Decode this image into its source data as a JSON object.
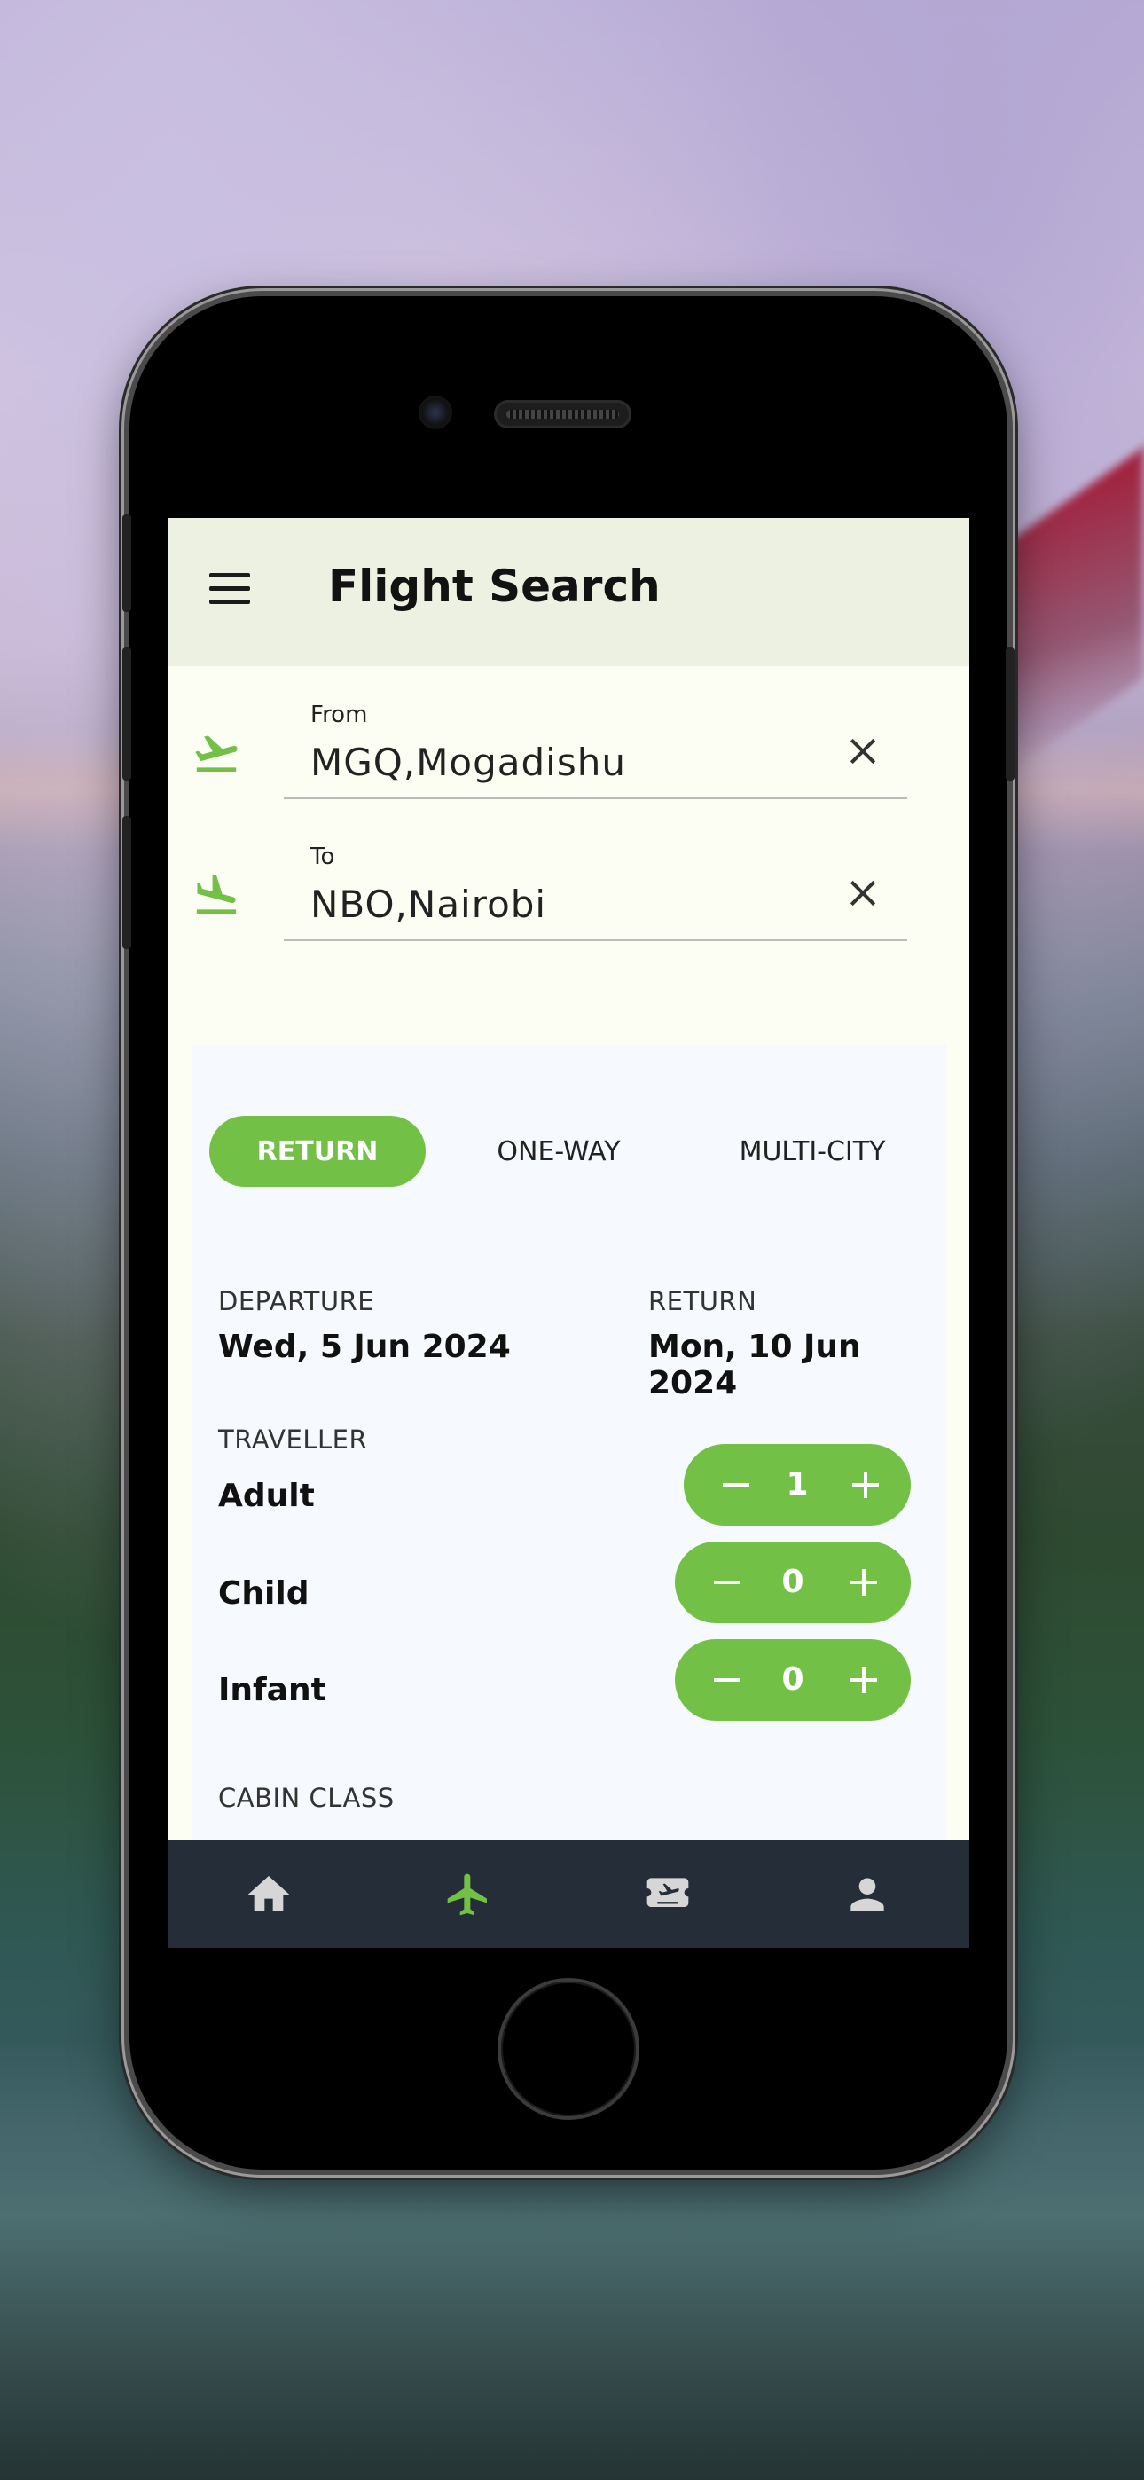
{
  "app": {
    "title": "Flight Search"
  },
  "route": {
    "from": {
      "label": "From",
      "value": "MGQ,Mogadishu"
    },
    "to": {
      "label": "To",
      "value": "NBO,Nairobi"
    }
  },
  "trip_type": {
    "options": [
      "RETURN",
      "ONE-WAY",
      "MULTI-CITY"
    ],
    "selected": "RETURN"
  },
  "dates": {
    "departure_label": "DEPARTURE",
    "departure_value": "Wed, 5 Jun 2024",
    "return_label": "RETURN",
    "return_value": "Mon, 10 Jun 2024"
  },
  "travellers": {
    "section_label": "TRAVELLER",
    "rows": [
      {
        "name": "Adult",
        "count": "1"
      },
      {
        "name": "Child",
        "count": "0"
      },
      {
        "name": "Infant",
        "count": "0"
      }
    ]
  },
  "cabin": {
    "section_label": "CABIN CLASS"
  },
  "bottom_nav": {
    "items": [
      "home-icon",
      "flight-icon",
      "ticket-icon",
      "profile-icon"
    ],
    "active": "flight-icon"
  },
  "colors": {
    "accent": "#72c045",
    "appbar": "#ecf1e1",
    "nav": "#242d38"
  }
}
